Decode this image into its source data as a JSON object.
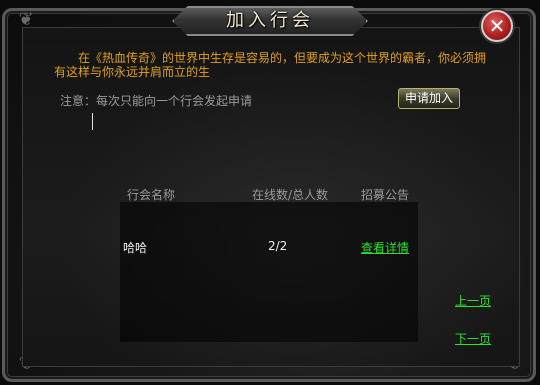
{
  "window": {
    "title": "加入行会",
    "close_icon": "✕"
  },
  "intro_text": "在《热血传奇》的世界中生存是容易的，但要成为这个世界的霸者，你必须拥有这样与你永远并肩而立的生",
  "notice_text": "注意：每次只能向一个行会发起申请",
  "apply_button_label": "申请加入",
  "table": {
    "columns": [
      "行会名称",
      "在线数/总人数",
      "招募公告"
    ],
    "rows": [
      {
        "name": "哈哈",
        "online": "2/2",
        "detail": "查看详情"
      }
    ]
  },
  "pagination": {
    "prev_label": "上一页",
    "next_label": "下一页"
  },
  "colors": {
    "intro_text": "#e0a020",
    "link": "#2ee02e",
    "close_button": "#b02020"
  }
}
